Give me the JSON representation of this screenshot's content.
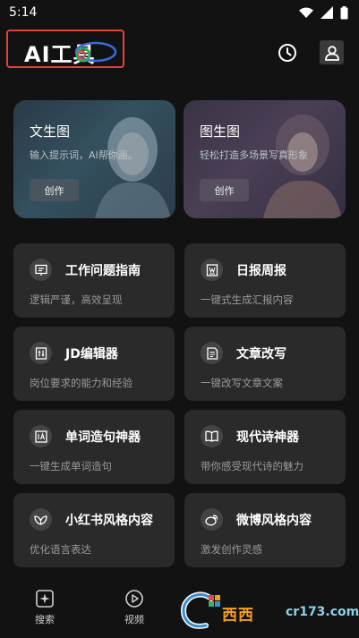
{
  "status_bar": {
    "time": "5:14"
  },
  "header": {
    "title": "AI工具"
  },
  "feature_cards": [
    {
      "title": "文生图",
      "subtitle": "输入提示词，AI帮你画。",
      "button": "创作"
    },
    {
      "title": "图生图",
      "subtitle": "轻松打造多场景写真形象",
      "button": "创作"
    }
  ],
  "tools": [
    {
      "title": "工作问题指南",
      "subtitle": "逻辑严谨，高效呈现",
      "icon": "presentation-icon"
    },
    {
      "title": "日报周报",
      "subtitle": "一键式生成汇报内容",
      "icon": "report-icon"
    },
    {
      "title": "JD编辑器",
      "subtitle": "岗位要求的能力和经验",
      "icon": "jd-editor-icon"
    },
    {
      "title": "文章改写",
      "subtitle": "一键改写文章文案",
      "icon": "article-icon"
    },
    {
      "title": "单词造句神器",
      "subtitle": "一键生成单词造句",
      "icon": "word-icon"
    },
    {
      "title": "现代诗神器",
      "subtitle": "带你感受现代诗的魅力",
      "icon": "book-icon"
    },
    {
      "title": "小红书风格内容",
      "subtitle": "优化语言表达",
      "icon": "leaf-icon"
    },
    {
      "title": "微博风格内容",
      "subtitle": "激发创作灵感",
      "icon": "weibo-icon"
    }
  ],
  "bottom_nav": [
    {
      "label": "搜索",
      "icon": "sparkle-icon"
    },
    {
      "label": "视频",
      "icon": "play-icon"
    }
  ],
  "watermark": {
    "text": "西西",
    "site": "cr173.com"
  }
}
